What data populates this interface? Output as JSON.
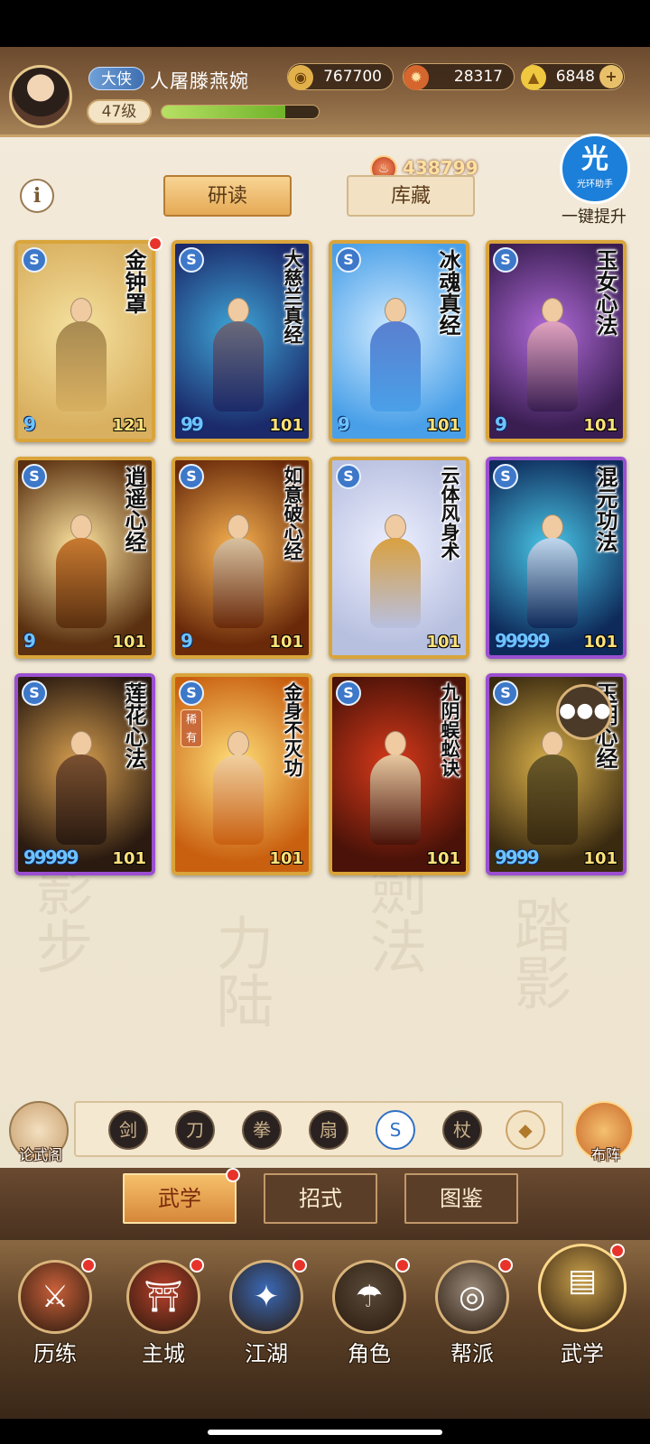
{
  "header": {
    "rank": "大侠",
    "player_name": "人屠滕燕婉",
    "level": "47级",
    "exp_fraction": 0.79,
    "coins": "767700",
    "tokens": "28317",
    "gold": "6848",
    "power": "438799",
    "add_symbol": "+"
  },
  "subheader": {
    "info": "i",
    "tab_active": "研读",
    "tab_inactive": "库藏",
    "helper_big": "光",
    "helper_small": "光环助手",
    "one_key": "一键提升"
  },
  "cards": [
    {
      "name": "金钟罩",
      "level": "121",
      "stars": "9",
      "frame": "gold",
      "art": [
        "#d9b060",
        "#f5e2a0",
        "#a78a52"
      ]
    },
    {
      "name": "大慈兰真经",
      "level": "101",
      "stars": "99",
      "frame": "gold",
      "art": [
        "#1b2a6a",
        "#3fa6d8",
        "#6a6a7a"
      ]
    },
    {
      "name": "冰魂真经",
      "level": "101",
      "stars": "9",
      "frame": "gold",
      "art": [
        "#4aa0e8",
        "#cfeaff",
        "#5a7fd0"
      ]
    },
    {
      "name": "玉女心法",
      "level": "101",
      "stars": "9",
      "frame": "gold",
      "art": [
        "#3a1e52",
        "#b06ad8",
        "#e2a3c0"
      ]
    },
    {
      "name": "逍遥心经",
      "level": "101",
      "stars": "9",
      "frame": "gold",
      "art": [
        "#5a3010",
        "#ffe6a0",
        "#c97a30"
      ]
    },
    {
      "name": "如意破心经",
      "level": "101",
      "stars": "9",
      "frame": "gold",
      "art": [
        "#6a2a0a",
        "#f7b250",
        "#d8c2a0"
      ]
    },
    {
      "name": "云体风身术",
      "level": "101",
      "stars": "",
      "frame": "gold",
      "art": [
        "#b8c0e0",
        "#eef0ff",
        "#d9a040"
      ]
    },
    {
      "name": "混元功法",
      "level": "101",
      "stars": "99999",
      "frame": "purple",
      "art": [
        "#0e2a5a",
        "#4ac8e8",
        "#c0d8ee"
      ]
    },
    {
      "name": "莲花心法",
      "level": "101",
      "stars": "99999",
      "frame": "purple",
      "art": [
        "#2a1a10",
        "#d8a050",
        "#7a5030"
      ]
    },
    {
      "name": "金身不灭功",
      "level": "101",
      "stars": "",
      "frame": "gold",
      "art": [
        "#c96010",
        "#ffe07a",
        "#f0d0a0"
      ],
      "rare": "稀有"
    },
    {
      "name": "九阴蜈蚣诀",
      "level": "101",
      "stars": "",
      "frame": "gold",
      "art": [
        "#4a1208",
        "#d83a1a",
        "#e8c8a0"
      ]
    },
    {
      "name": "玉明心经",
      "level": "101",
      "stars": "9999",
      "frame": "purple",
      "art": [
        "#3a2a10",
        "#d9b04a",
        "#6a5a2a"
      ]
    }
  ],
  "side": {
    "left_label": "论武阁",
    "right_label": "布阵"
  },
  "filters": [
    "剑",
    "刀",
    "拳",
    "扇",
    "S",
    "杖",
    "◆"
  ],
  "subtabs": [
    "武学",
    "招式",
    "图鉴"
  ],
  "nav": [
    {
      "label": "历练",
      "color": "#c9603a"
    },
    {
      "label": "主城",
      "color": "#b8402a"
    },
    {
      "label": "江湖",
      "color": "#3a6ab8"
    },
    {
      "label": "角色",
      "color": "#5a4a3a"
    },
    {
      "label": "帮派",
      "color": "#9a8a7a"
    },
    {
      "label": "武学",
      "color": "#c9a04a"
    }
  ],
  "icons": {
    "coin": "coin-icon",
    "token": "flame-token-icon",
    "gold": "gold-ingot-icon",
    "power": "power-icon",
    "chat": "chat-icon"
  },
  "colors": {
    "gold_frame": "#d9a43a",
    "purple_frame": "#9b4fd0",
    "notify": "#e8332a"
  }
}
